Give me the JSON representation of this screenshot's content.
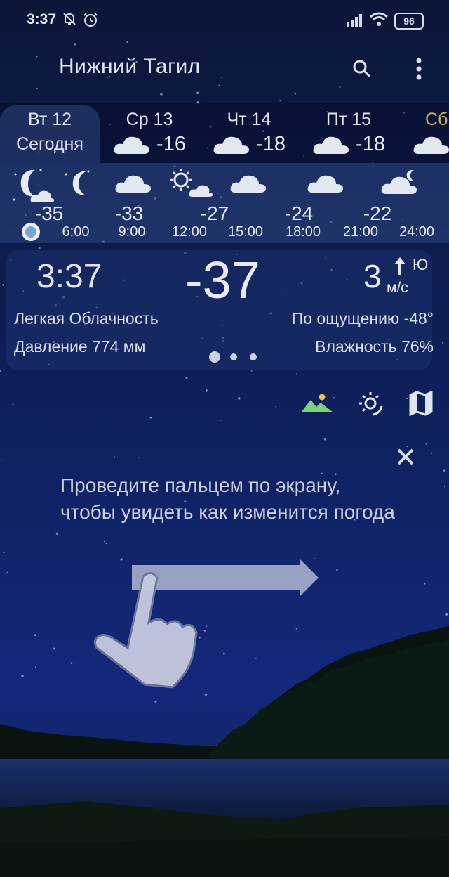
{
  "status_bar": {
    "time": "3:37",
    "battery": "96"
  },
  "header": {
    "city": "Нижний Тагил"
  },
  "days": [
    {
      "name": "Вт 12",
      "sub": "Сегодня",
      "active": true
    },
    {
      "name": "Ср 13",
      "temp": "-16",
      "icon": "cloud-icon"
    },
    {
      "name": "Чт 14",
      "temp": "-18",
      "icon": "cloud-icon"
    },
    {
      "name": "Пт 15",
      "temp": "-18",
      "icon": "cloud-icon"
    },
    {
      "name": "Сб",
      "icon": "cloud-icon"
    }
  ],
  "hourly": [
    {
      "temp": "-35",
      "time": "",
      "icon": "moon-cloud-icon"
    },
    {
      "temp": "",
      "time": "6:00",
      "icon": "moon-icon"
    },
    {
      "temp": "-33",
      "time": "9:00",
      "icon": "cloud-icon"
    },
    {
      "temp": "-27",
      "time": "12:00",
      "icon": "sun-cloud-icon"
    },
    {
      "temp": "",
      "time": "15:00",
      "icon": "cloud-icon"
    },
    {
      "temp": "-24",
      "time": "18:00",
      "icon": "cloud-icon"
    },
    {
      "temp": "-22",
      "time": "21:00",
      "icon": "cloud-icon"
    },
    {
      "temp": "",
      "time": "24:00",
      "icon": "moon-cloud-icon"
    }
  ],
  "current": {
    "time": "3:37",
    "temp": "-37",
    "wind_speed": "3",
    "wind_unit": "м/с",
    "wind_dir": "Ю",
    "condition": "Легкая Облачность",
    "feels_like": "По ощущению -48°",
    "pressure": "Давление 774 мм",
    "humidity": "Влажность 76%"
  },
  "hint": {
    "text": "Проведите пальцем по экрану, чтобы увидеть как изменится погода"
  },
  "colors": {
    "accent_day": "#c9b15a",
    "landscape_icon": "#7bd27b",
    "sun_icon": "#e8c64a"
  }
}
